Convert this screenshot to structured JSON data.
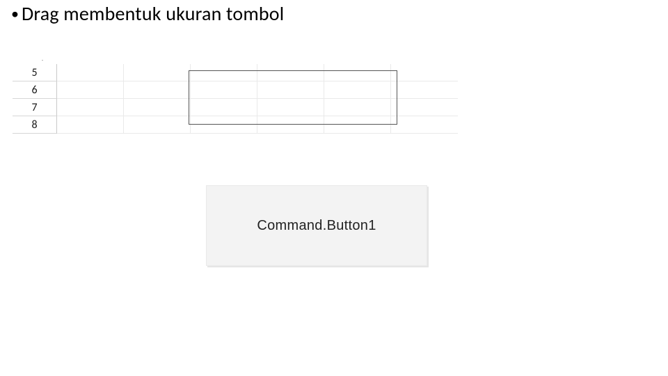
{
  "bullet": {
    "marker": "•",
    "text": "Drag membentuk ukuran tombol"
  },
  "grid": {
    "tiny_mark": ".",
    "row_headers": [
      "5",
      "6",
      "7",
      "8"
    ]
  },
  "button": {
    "label": "Command.Button1"
  }
}
